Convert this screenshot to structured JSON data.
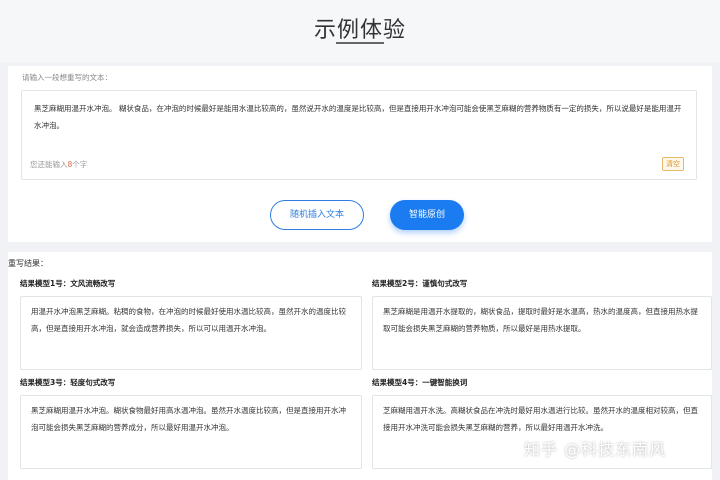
{
  "page": {
    "title": "示例体验"
  },
  "input": {
    "label": "请输入一段想重写的文本：",
    "text": "黑芝麻糊用温开水冲泡。 糊状食品，在冲泡的时候最好是能用水温比较高的，虽然说开水的温度是比较高，但是直接用开水冲泡可能会使黑芝麻糊的营养物质有一定的损失，所以说最好是能用温开水冲泡。",
    "counter_prefix": "您还能输入",
    "counter_value": "8",
    "counter_suffix": "个字",
    "clear_label": "清空"
  },
  "actions": {
    "random_insert_label": "随机插入文本",
    "smart_rewrite_label": "智能原创"
  },
  "results": {
    "heading": "重写结果：",
    "items": [
      {
        "title": "结果模型1号：文风流畅改写",
        "text": "用温开水冲泡黑芝麻糊。粘稠的食物，在冲泡的时候最好使用水温比较高，虽然开水的温度比较高，但是直接用开水冲泡，就会造成营养损失，所以可以用温开水冲泡。"
      },
      {
        "title": "结果模型2号：谨慎句式改写",
        "text": "黑芝麻糊是用温开水提取的，糊状食品，提取时最好是水温高，热水的温度高，但直接用热水提取可能会损失黑芝麻糊的营养物质，所以最好是用热水提取。"
      },
      {
        "title": "结果模型3号：轻度句式改写",
        "text": "黑芝麻糊用温开水冲泡。糊状食物最好用高水温冲泡。虽然开水温度比较高，但是直接用开水冲泡可能会损失黑芝麻糊的营养成分，所以最好用温开水冲泡。"
      },
      {
        "title": "结果模型4号：一键智能换词",
        "text": "芝麻糊用温开水洗。高糊状食品在冲洗时最好用水温进行比较。虽然开水的温度相对较高，但直接用开水冲洗可能会损失黑芝麻糊的营养，所以最好用温开水冲洗。"
      }
    ]
  },
  "watermark": "知乎 @科技东南风"
}
